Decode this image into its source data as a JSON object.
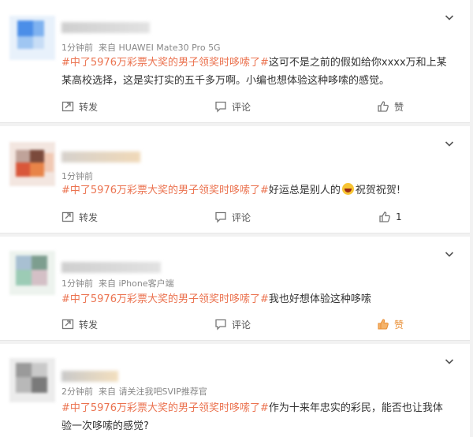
{
  "comments": [
    {
      "time": "1分钟前",
      "source": "来自 HUAWEI Mate30 Pro 5G",
      "topic": "#中了5976万彩票大奖的男子领奖时哆嗦了#",
      "text": "这可不是之前的假如给你xxxx万和上某某高校选择，这是实打实的五千多万啊。小编也想体验这种哆嗦的感觉。",
      "repost": "转发",
      "comment": "评论",
      "like": "赞"
    },
    {
      "time": "1分钟前",
      "source": "",
      "topic": "#中了5976万彩票大奖的男子领奖时哆嗦了#",
      "text": "好运总是别人的",
      "emoji": "laughing-face-emoji",
      "text_after": "祝贺祝贺!",
      "repost": "转发",
      "comment": "评论",
      "like": "1"
    },
    {
      "time": "1分钟前",
      "source": "来自 iPhone客户端",
      "topic": "#中了5976万彩票大奖的男子领奖时哆嗦了#",
      "text": "我也好想体验这种哆嗦",
      "repost": "转发",
      "comment": "评论",
      "like": "赞",
      "liked": true
    },
    {
      "time": "2分钟前",
      "source": "来自 请关注我吧SVIP推荐官",
      "topic": "#中了5976万彩票大奖的男子领奖时哆嗦了#",
      "text": "作为十来年忠实的彩民，能否也让我体验一次哆嗦的感觉?"
    }
  ],
  "colors": {
    "topic": "#eb7350",
    "liked": "#e98f36",
    "meta": "#888888"
  }
}
